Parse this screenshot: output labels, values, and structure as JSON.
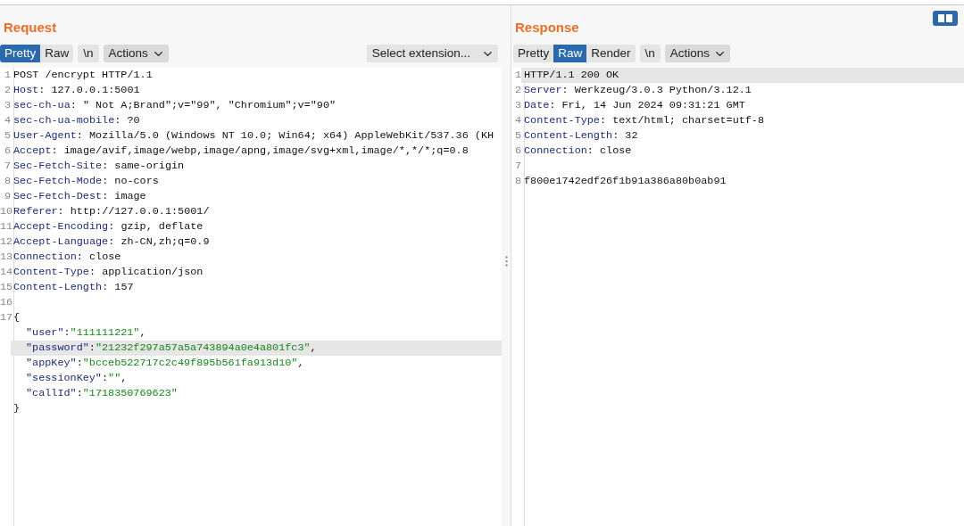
{
  "request": {
    "title": "Request",
    "tabs": [
      {
        "label": "Pretty",
        "selected": true
      },
      {
        "label": "Raw",
        "selected": false
      }
    ],
    "newline_toggle": {
      "label": "\\n"
    },
    "actions": {
      "label": "Actions"
    },
    "extension_select": {
      "value": "Select extension..."
    },
    "lines": [
      {
        "number": "1",
        "kind": "text",
        "text": "POST /encrypt HTTP/1.1",
        "highlighted": false
      },
      {
        "number": "2",
        "kind": "header",
        "name": "Host",
        "sep": ":",
        "value": " 127.0.0.1:5001",
        "highlighted": false
      },
      {
        "number": "3",
        "kind": "header",
        "name": "sec-ch-ua",
        "sep": ":",
        "value": " \" Not A;Brand\";v=\"99\", \"Chromium\";v=\"90\"",
        "highlighted": false
      },
      {
        "number": "4",
        "kind": "header",
        "name": "sec-ch-ua-mobile",
        "sep": ":",
        "value": " ?0",
        "highlighted": false
      },
      {
        "number": "5",
        "kind": "header",
        "name": "User-Agent",
        "sep": ":",
        "value": " Mozilla/5.0 (Windows NT 10.0; Win64; x64) AppleWebKit/537.36 (KH",
        "highlighted": false
      },
      {
        "number": "6",
        "kind": "header",
        "name": "Accept",
        "sep": ":",
        "value": " image/avif,image/webp,image/apng,image/svg+xml,image/*,*/*;q=0.8",
        "highlighted": false
      },
      {
        "number": "7",
        "kind": "header",
        "name": "Sec-Fetch-Site",
        "sep": ":",
        "value": " same-origin",
        "highlighted": false
      },
      {
        "number": "8",
        "kind": "header",
        "name": "Sec-Fetch-Mode",
        "sep": ":",
        "value": " no-cors",
        "highlighted": false
      },
      {
        "number": "9",
        "kind": "header",
        "name": "Sec-Fetch-Dest",
        "sep": ":",
        "value": " image",
        "highlighted": false
      },
      {
        "number": "10",
        "kind": "header",
        "name": "Referer",
        "sep": ":",
        "value": " http://127.0.0.1:5001/",
        "highlighted": false
      },
      {
        "number": "11",
        "kind": "header",
        "name": "Accept-Encoding",
        "sep": ":",
        "value": " gzip, deflate",
        "highlighted": false
      },
      {
        "number": "12",
        "kind": "header",
        "name": "Accept-Language",
        "sep": ":",
        "value": " zh-CN,zh;q=0.9",
        "highlighted": false
      },
      {
        "number": "13",
        "kind": "header",
        "name": "Connection",
        "sep": ":",
        "value": " close",
        "highlighted": false
      },
      {
        "number": "14",
        "kind": "header",
        "name": "Content-Type",
        "sep": ":",
        "value": " application/json",
        "highlighted": false
      },
      {
        "number": "15",
        "kind": "header",
        "name": "Content-Length",
        "sep": ":",
        "value": " 157",
        "highlighted": false
      },
      {
        "number": "16",
        "kind": "blank",
        "highlighted": false
      },
      {
        "number": "17",
        "kind": "json",
        "open": "{",
        "close": "}",
        "fields": [
          {
            "key": "\"user\"",
            "sep": ":",
            "value": "\"111111221\"",
            "trail": ",",
            "highlighted": false
          },
          {
            "key": "\"password\"",
            "sep": ":",
            "value": "\"21232f297a57a5a743894a0e4a801fc3\"",
            "trail": ",",
            "highlighted": true
          },
          {
            "key": "\"appKey\"",
            "sep": ":",
            "value": "\"bcceb522717c2c49f895b561fa913d10\"",
            "trail": ",",
            "highlighted": false
          },
          {
            "key": "\"sessionKey\"",
            "sep": ":",
            "value": "\"\"",
            "trail": ",",
            "highlighted": false
          },
          {
            "key": "\"callId\"",
            "sep": ":",
            "value": "\"1718350769623\"",
            "highlighted": false
          }
        ]
      }
    ]
  },
  "response": {
    "title": "Response",
    "layout_toggle": {
      "selected": true
    },
    "tabs": [
      {
        "label": "Pretty",
        "selected": false
      },
      {
        "label": "Raw",
        "selected": true
      },
      {
        "label": "Render",
        "selected": false
      }
    ],
    "newline_toggle": {
      "label": "\\n"
    },
    "actions": {
      "label": "Actions"
    },
    "lines": [
      {
        "number": "1",
        "kind": "text",
        "text": "HTTP/1.1 200 OK",
        "highlighted": true
      },
      {
        "number": "2",
        "kind": "header",
        "name": "Server",
        "sep": ":",
        "value": " Werkzeug/3.0.3 Python/3.12.1",
        "highlighted": false
      },
      {
        "number": "3",
        "kind": "header",
        "name": "Date",
        "sep": ":",
        "value": " Fri, 14 Jun 2024 09:31:21 GMT",
        "highlighted": false
      },
      {
        "number": "4",
        "kind": "header",
        "name": "Content-Type",
        "sep": ":",
        "value": " text/html; charset=utf-8",
        "highlighted": false
      },
      {
        "number": "5",
        "kind": "header",
        "name": "Content-Length",
        "sep": ":",
        "value": " 32",
        "highlighted": false
      },
      {
        "number": "6",
        "kind": "header",
        "name": "Connection",
        "sep": ":",
        "value": " close",
        "highlighted": false
      },
      {
        "number": "7",
        "kind": "blank",
        "highlighted": false
      },
      {
        "number": "8",
        "kind": "text",
        "text": "f800e1742edf26f1b91a386a80b0ab91",
        "highlighted": false
      }
    ]
  }
}
